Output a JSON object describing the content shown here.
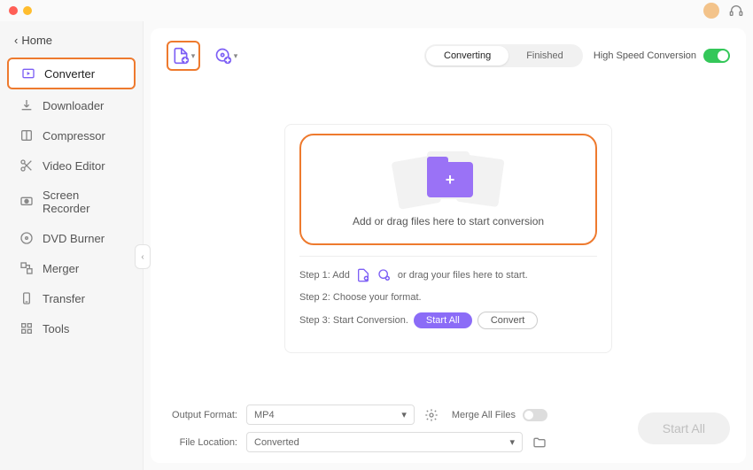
{
  "home": "Home",
  "sidebar": {
    "items": [
      {
        "label": "Converter"
      },
      {
        "label": "Downloader"
      },
      {
        "label": "Compressor"
      },
      {
        "label": "Video Editor"
      },
      {
        "label": "Screen Recorder"
      },
      {
        "label": "DVD Burner"
      },
      {
        "label": "Merger"
      },
      {
        "label": "Transfer"
      },
      {
        "label": "Tools"
      }
    ]
  },
  "tabs": {
    "converting": "Converting",
    "finished": "Finished"
  },
  "high_speed_label": "High Speed Conversion",
  "drop_label": "Add or drag files here to start conversion",
  "steps": {
    "s1_prefix": "Step 1: Add",
    "s1_suffix": "or drag your files here to start.",
    "s2": "Step 2: Choose your format.",
    "s3_prefix": "Step 3: Start Conversion.",
    "start_all_pill": "Start  All",
    "convert_pill": "Convert"
  },
  "footer": {
    "output_format_label": "Output Format:",
    "output_format_value": "MP4",
    "file_location_label": "File Location:",
    "file_location_value": "Converted",
    "merge_label": "Merge All Files",
    "start_all_button": "Start All"
  }
}
